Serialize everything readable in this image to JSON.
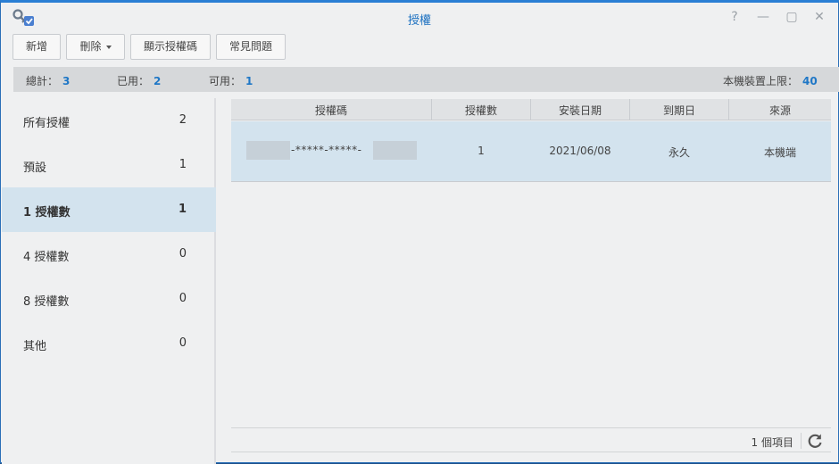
{
  "window": {
    "title": "授權",
    "controls": {
      "help": "?",
      "minimize": "—",
      "maximize": "▢",
      "close": "✕"
    },
    "icon": "key-license-icon",
    "accent": "#1a6fc0"
  },
  "toolbar": {
    "add": "新增",
    "delete": "刪除",
    "show_codes": "顯示授權碼",
    "faq": "常見問題"
  },
  "summary": {
    "total_label": "總計：",
    "total_value": "3",
    "used_label": "已用：",
    "used_value": "2",
    "available_label": "可用：",
    "available_value": "1",
    "limit_label": "本機裝置上限：",
    "limit_value": "40"
  },
  "sidebar": {
    "items": [
      {
        "label": "所有授權",
        "count": "2",
        "active": false
      },
      {
        "label": "預設",
        "count": "1",
        "active": false
      },
      {
        "label": "1 授權數",
        "count": "1",
        "active": true
      },
      {
        "label": "4 授權數",
        "count": "0",
        "active": false
      },
      {
        "label": "8 授權數",
        "count": "0",
        "active": false
      },
      {
        "label": "其他",
        "count": "0",
        "active": false
      }
    ]
  },
  "grid": {
    "columns": [
      "授權碼",
      "授權數",
      "安裝日期",
      "到期日",
      "來源"
    ],
    "rows": [
      {
        "code_masked": "-*****-*****-",
        "licenses": "1",
        "install_date": "2021/06/08",
        "expiry": "永久",
        "source": "本機端"
      }
    ]
  },
  "footer": {
    "item_count": "1 個項目",
    "refresh_icon": "refresh-icon"
  }
}
